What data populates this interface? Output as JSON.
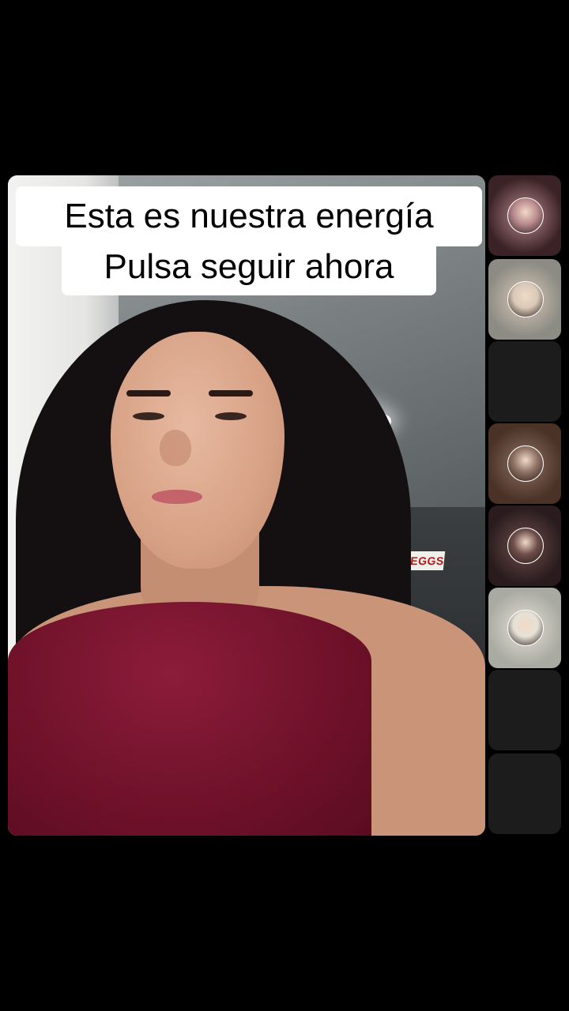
{
  "caption": {
    "line1": "Esta es nuestra energía",
    "line2": "Pulsa seguir ahora"
  },
  "background_sign": "MILK·EGGS",
  "participants": [
    {
      "name": "participant-1",
      "has_avatar": true,
      "tile_color": "#3a2226",
      "avatar_color": "#b98a8e"
    },
    {
      "name": "participant-2",
      "has_avatar": true,
      "tile_color": "#8c8b84",
      "avatar_color": "#d9c9b8"
    },
    {
      "name": "participant-3",
      "has_avatar": false,
      "tile_color": "#1c1c1c"
    },
    {
      "name": "participant-4",
      "has_avatar": true,
      "tile_color": "#4a3226",
      "avatar_color": "#8e7264"
    },
    {
      "name": "participant-5",
      "has_avatar": true,
      "tile_color": "#2a1c1e",
      "avatar_color": "#6e4e4a"
    },
    {
      "name": "participant-6",
      "has_avatar": true,
      "tile_color": "#a9aaa2",
      "avatar_color": "#e6e1d6"
    },
    {
      "name": "participant-7",
      "has_avatar": false,
      "tile_color": "#1c1c1c"
    },
    {
      "name": "participant-8",
      "has_avatar": false,
      "tile_color": "#1c1c1c"
    }
  ],
  "colors": {
    "background": "#000000",
    "caption_bg": "#ffffff",
    "caption_text": "#000000",
    "shirt": "#7a1530"
  }
}
